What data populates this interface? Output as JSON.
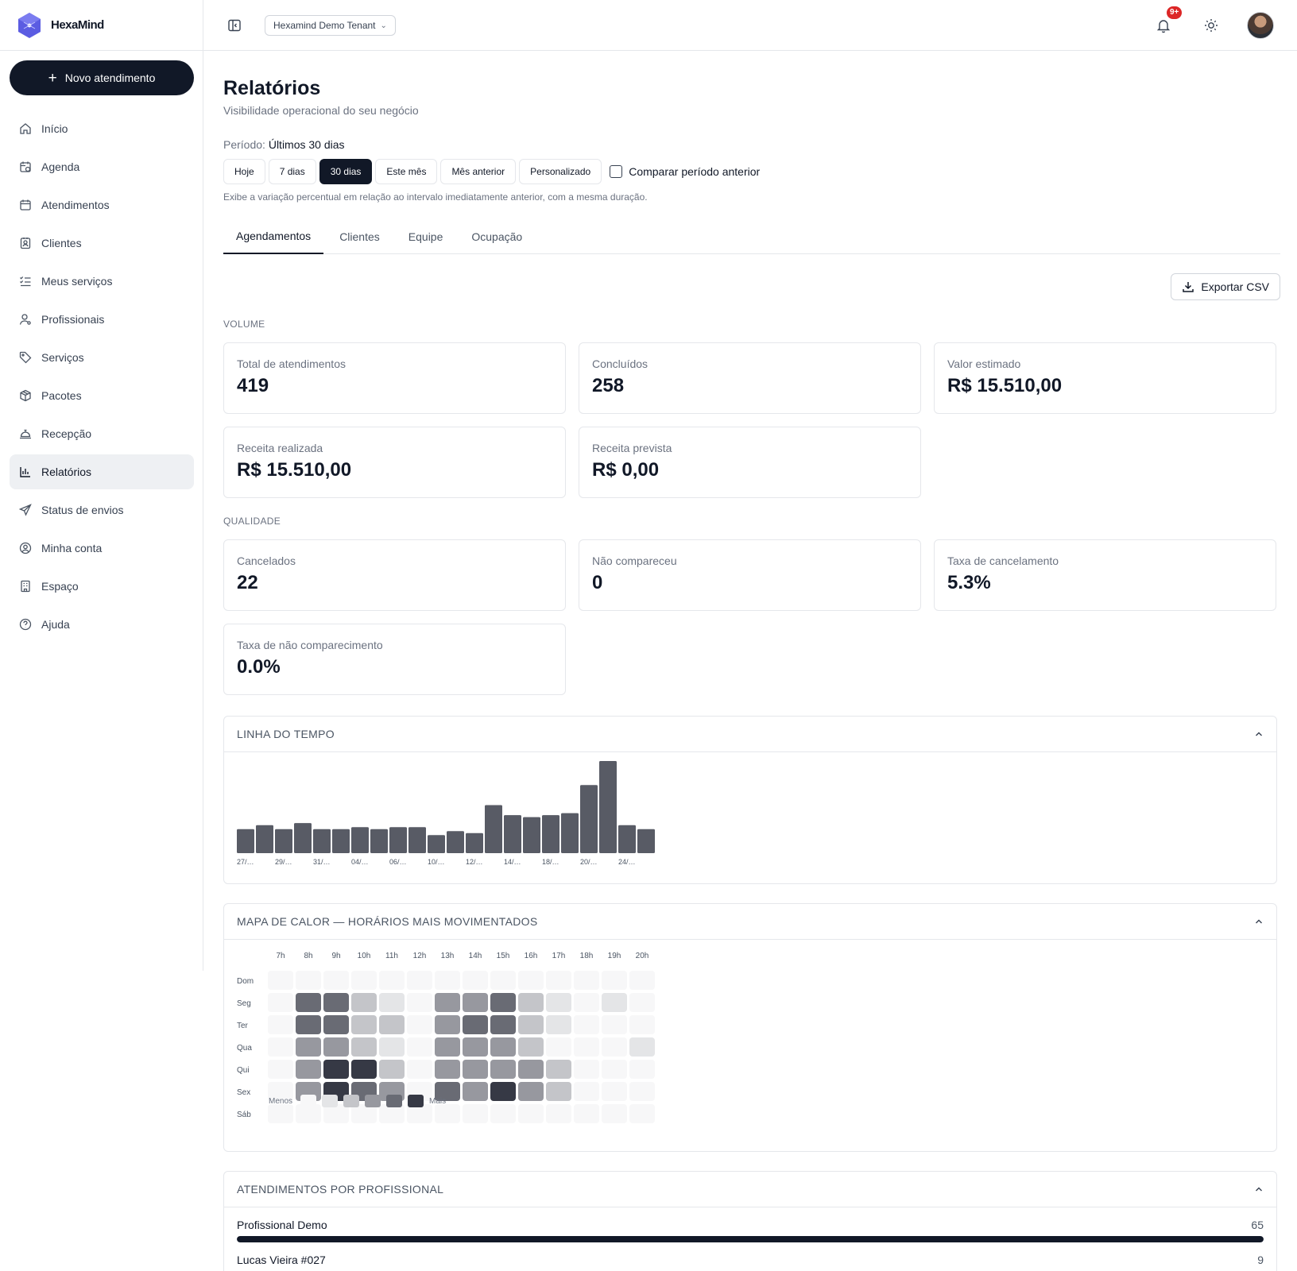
{
  "app": {
    "brand": "HexaMind"
  },
  "sidebar": {
    "new_button": "Novo atendimento",
    "items": [
      {
        "label": "Início",
        "icon": "home-icon"
      },
      {
        "label": "Agenda",
        "icon": "calendar-clock-icon"
      },
      {
        "label": "Atendimentos",
        "icon": "calendar-icon"
      },
      {
        "label": "Clientes",
        "icon": "contact-icon"
      },
      {
        "label": "Meus serviços",
        "icon": "list-checks-icon"
      },
      {
        "label": "Profissionais",
        "icon": "user-icon"
      },
      {
        "label": "Serviços",
        "icon": "tag-icon"
      },
      {
        "label": "Pacotes",
        "icon": "package-icon"
      },
      {
        "label": "Recepção",
        "icon": "bell-concierge-icon"
      },
      {
        "label": "Relatórios",
        "icon": "bar-chart-icon",
        "active": true
      },
      {
        "label": "Status de envios",
        "icon": "send-icon"
      },
      {
        "label": "Minha conta",
        "icon": "user-circle-icon"
      },
      {
        "label": "Espaço",
        "icon": "building-icon"
      },
      {
        "label": "Ajuda",
        "icon": "help-circle-icon"
      }
    ]
  },
  "header": {
    "tenant": "Hexamind Demo Tenant",
    "notifications_badge": "9+"
  },
  "page": {
    "title": "Relatórios",
    "subtitle": "Visibilidade operacional do seu negócio",
    "period_label": "Período:",
    "period_value": "Últimos 30 dias",
    "period_buttons": [
      "Hoje",
      "7 dias",
      "30 dias",
      "Este mês",
      "Mês anterior",
      "Personalizado"
    ],
    "period_selected": "30 dias",
    "compare_label": "Comparar período anterior",
    "compare_checked": false,
    "hint": "Exibe a variação percentual em relação ao intervalo imediatamente anterior, com a mesma duração.",
    "tabs": [
      "Agendamentos",
      "Clientes",
      "Equipe",
      "Ocupação"
    ],
    "active_tab": "Agendamentos",
    "export_label": "Exportar CSV"
  },
  "volume": {
    "section": "VOLUME",
    "cards": [
      {
        "label": "Total de atendimentos",
        "value": "419"
      },
      {
        "label": "Concluídos",
        "value": "258"
      },
      {
        "label": "Valor estimado",
        "value": "R$ 15.510,00"
      },
      {
        "label": "Receita realizada",
        "value": "R$ 15.510,00"
      },
      {
        "label": "Receita prevista",
        "value": "R$ 0,00"
      }
    ]
  },
  "quality": {
    "section": "QUALIDADE",
    "cards": [
      {
        "label": "Cancelados",
        "value": "22"
      },
      {
        "label": "Não compareceu",
        "value": "0"
      },
      {
        "label": "Taxa de cancelamento",
        "value": "5.3%"
      },
      {
        "label": "Taxa de não comparecimento",
        "value": "0.0%"
      }
    ]
  },
  "timeline": {
    "title": "LINHA DO TEMPO",
    "chart_data": {
      "type": "bar",
      "tick_labels": [
        "27/…",
        "29/…",
        "31/…",
        "04/…",
        "06/…",
        "10/…",
        "12/…",
        "14/…",
        "18/…",
        "20/…",
        "24/…"
      ],
      "values": [
        12,
        14,
        12,
        15,
        12,
        12,
        13,
        12,
        13,
        13,
        9,
        11,
        10,
        24,
        19,
        18,
        19,
        20,
        34,
        46,
        14,
        12
      ],
      "color": "#585b65"
    }
  },
  "heatmap": {
    "title": "MAPA DE CALOR — HORÁRIOS MAIS MOVIMENTADOS",
    "chart_data": {
      "type": "heatmap",
      "hours": [
        "7h",
        "8h",
        "9h",
        "10h",
        "11h",
        "12h",
        "13h",
        "14h",
        "15h",
        "16h",
        "17h",
        "18h",
        "19h",
        "20h"
      ],
      "days": [
        "Dom",
        "Seg",
        "Ter",
        "Qua",
        "Qui",
        "Sex",
        "Sáb"
      ],
      "levels": [
        [
          0,
          0,
          0,
          0,
          0,
          0,
          0,
          0,
          0,
          0,
          0,
          0,
          0,
          0
        ],
        [
          0,
          4,
          4,
          2,
          1,
          0,
          3,
          3,
          4,
          2,
          1,
          0,
          1,
          0
        ],
        [
          0,
          4,
          4,
          2,
          2,
          0,
          3,
          4,
          4,
          2,
          1,
          0,
          0,
          0
        ],
        [
          0,
          3,
          3,
          2,
          1,
          0,
          3,
          3,
          3,
          2,
          0,
          0,
          0,
          1
        ],
        [
          0,
          3,
          5,
          5,
          2,
          0,
          3,
          3,
          3,
          3,
          2,
          0,
          0,
          0
        ],
        [
          0,
          3,
          5,
          4,
          3,
          0,
          4,
          3,
          5,
          3,
          2,
          0,
          0,
          0
        ],
        [
          0,
          0,
          0,
          0,
          0,
          0,
          0,
          0,
          0,
          0,
          0,
          0,
          0,
          0
        ]
      ],
      "scale_colors": [
        "#f7f7f8",
        "#e4e5e7",
        "#c4c5c9",
        "#97989f",
        "#696b74",
        "#363945"
      ]
    },
    "legend_less": "Menos",
    "legend_more": "Mais"
  },
  "by_professional": {
    "title": "ATENDIMENTOS POR PROFISSIONAL",
    "rows": [
      {
        "name": "Profissional Demo",
        "count": "65",
        "share": 1.0
      },
      {
        "name": "Lucas Vieira #027",
        "count": "9",
        "share": 0.14
      }
    ]
  }
}
